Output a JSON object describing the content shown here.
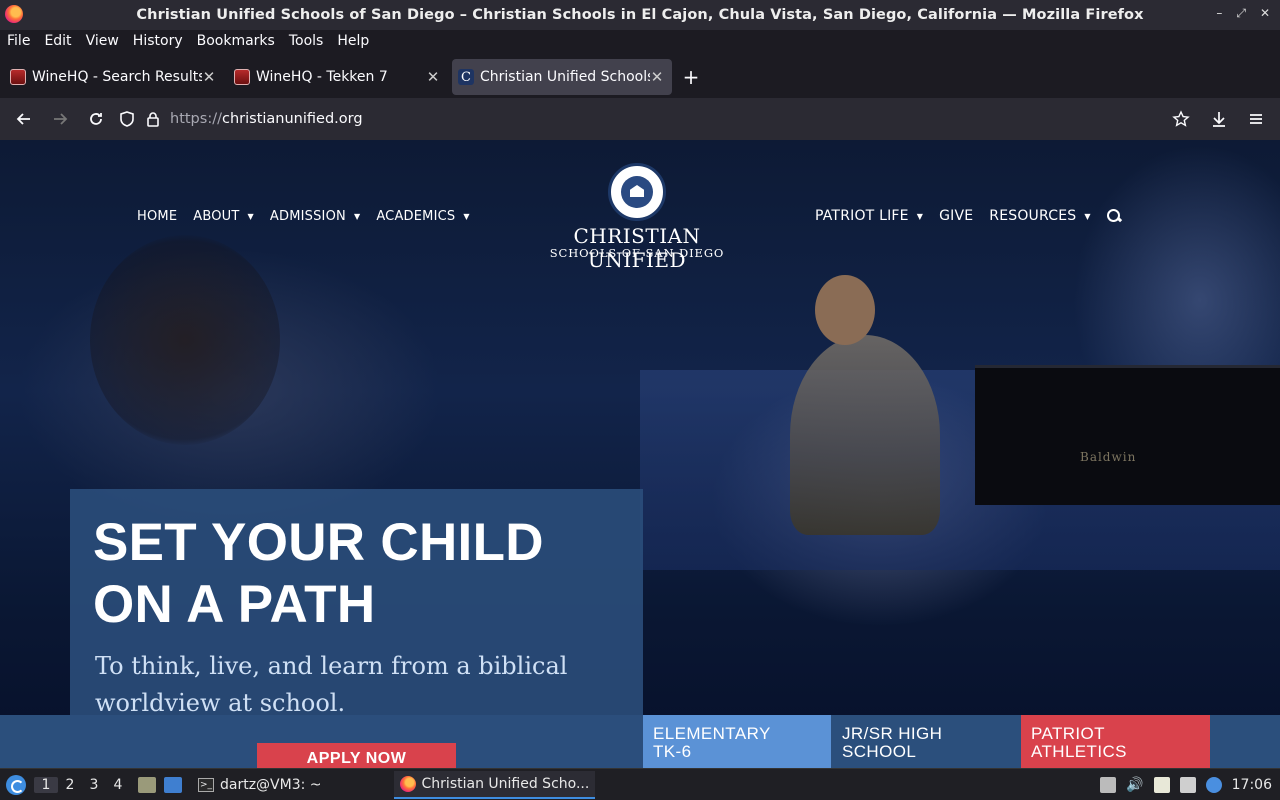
{
  "window": {
    "title": "Christian Unified Schools of San Diego – Christian Schools in El Cajon, Chula Vista, San Diego, California — Mozilla Firefox",
    "controls": [
      "–",
      "⤢",
      "✕"
    ]
  },
  "menubar": [
    "File",
    "Edit",
    "View",
    "History",
    "Bookmarks",
    "Tools",
    "Help"
  ],
  "tabs": [
    {
      "label": "WineHQ - Search Results",
      "favicon": "winehq-icon",
      "active": false
    },
    {
      "label": "WineHQ - Tekken 7",
      "favicon": "winehq-icon",
      "active": false
    },
    {
      "label": "Christian Unified Schools",
      "favicon": "cu-icon",
      "active": true
    }
  ],
  "nav": {
    "url_proto": "https://",
    "url_host": "christianunified.org"
  },
  "site": {
    "nav_left": [
      {
        "label": "HOME",
        "dropdown": false
      },
      {
        "label": "ABOUT",
        "dropdown": true
      },
      {
        "label": "ADMISSION",
        "dropdown": true
      },
      {
        "label": "ACADEMICS",
        "dropdown": true
      }
    ],
    "nav_right": [
      {
        "label": "PATRIOT LIFE",
        "dropdown": true
      },
      {
        "label": "GIVE",
        "dropdown": false
      },
      {
        "label": "RESOURCES",
        "dropdown": true
      }
    ],
    "logo_name": "CHRISTIAN UNIFIED",
    "logo_sub": "SCHOOLS OF SAN DIEGO",
    "piano_brand": "Baldwin"
  },
  "hero": {
    "title_line1": "SET YOUR CHILD",
    "title_line2": "ON A PATH",
    "subtitle": "To think, live, and learn from a biblical worldview at school.",
    "apply_label": "APPLY NOW"
  },
  "tiles": [
    {
      "line1": "ELEMENTARY",
      "line2": "TK-6",
      "color": "#5b92d6"
    },
    {
      "line1": "JR/SR HIGH",
      "line2": "SCHOOL",
      "color": "#2b4f7c"
    },
    {
      "line1": "PATRIOT",
      "line2": "ATHLETICS",
      "color": "#d9424c"
    }
  ],
  "taskbar": {
    "workspaces": [
      "1",
      "2",
      "3",
      "4"
    ],
    "tasks": [
      {
        "label": "dartz@VM3: ~",
        "active": false
      },
      {
        "label": "Christian Unified Scho...",
        "active": true
      }
    ],
    "clock": "17:06"
  }
}
